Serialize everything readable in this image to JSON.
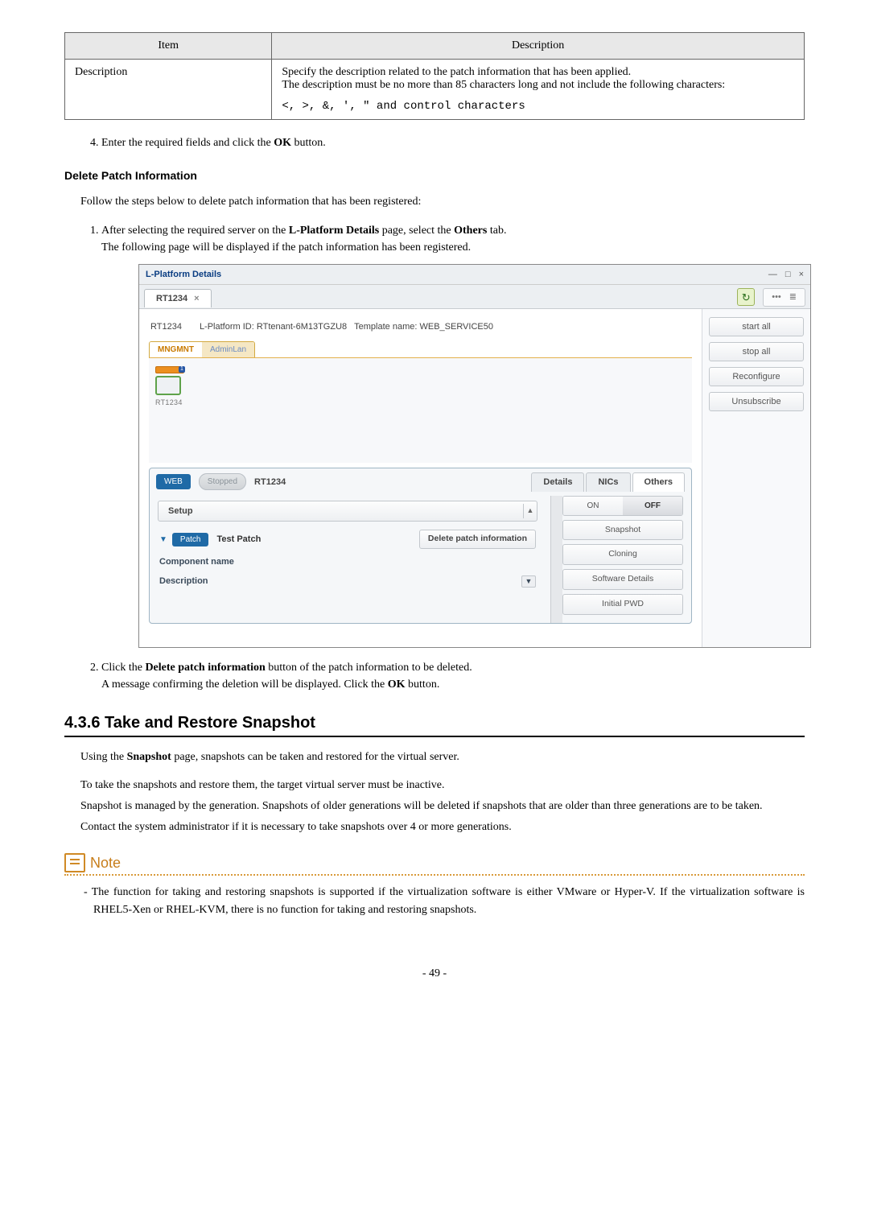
{
  "table": {
    "head_item": "Item",
    "head_desc": "Description",
    "row_item": "Description",
    "row_desc_line1": "Specify the description related to the patch information that has been applied.",
    "row_desc_line2": "The description must be no more than 85 characters long and not include the following characters:",
    "row_desc_code": "<, >, &, ', \" and control characters"
  },
  "step4_prefix": "Enter the required fields and click the ",
  "step4_bold": "OK",
  "step4_suffix": " button.",
  "delete_title": "Delete Patch Information",
  "delete_intro": "Follow the steps below to delete patch information that has been registered:",
  "dstep1_a": "After selecting the required server on the ",
  "dstep1_b": "L-Platform Details",
  "dstep1_c": " page, select the ",
  "dstep1_d": "Others",
  "dstep1_e": " tab.",
  "dstep1_line2": "The following page will be displayed if the patch information has been registered.",
  "ss": {
    "title": "L-Platform Details",
    "tab": "RT1234",
    "toolbar_dots": "•••",
    "refresh_glyph": "↻",
    "info_name": "RT1234",
    "info_lpid_label": "L-Platform ID:",
    "info_lpid_value": "RTtenant-6M13TGZU8",
    "info_tpl_label": "Template name:",
    "info_tpl_value": "WEB_SERVICE50",
    "mngmnt": "MNGMNT",
    "adminlan": "AdminLan",
    "node_label": "RT1234",
    "side": {
      "start_all": "start all",
      "stop_all": "stop all",
      "reconfigure": "Reconfigure",
      "unsubscribe": "Unsubscribe"
    },
    "lower": {
      "web": "WEB",
      "stopped": "Stopped",
      "srv": "RT1234",
      "tab_details": "Details",
      "tab_nics": "NICs",
      "tab_others": "Others",
      "on": "ON",
      "off": "OFF",
      "snapshot": "Snapshot",
      "cloning": "Cloning",
      "swdetails": "Software Details",
      "initialpwd": "Initial PWD",
      "setup": "Setup",
      "patch": "Patch",
      "test_patch": "Test Patch",
      "delete_patch": "Delete patch information",
      "component": "Component name",
      "description": "Description"
    }
  },
  "dstep2_a": "Click the ",
  "dstep2_b": "Delete patch information",
  "dstep2_c": " button of the patch information to be deleted.",
  "dstep2_line2a": "A message confirming the deletion will be displayed. Click the ",
  "dstep2_line2b": "OK",
  "dstep2_line2c": " button.",
  "section_title": "4.3.6  Take and Restore Snapshot",
  "sec_p1_a": "Using the ",
  "sec_p1_b": "Snapshot",
  "sec_p1_c": " page, snapshots can be taken and restored for the virtual server.",
  "sec_p2": "To take the snapshots and restore them, the target virtual server must be inactive.",
  "sec_p3": "Snapshot is managed by the generation. Snapshots of older generations will be deleted if snapshots that are older than three generations are to be taken.",
  "sec_p4": "Contact the system administrator if it is necessary to take snapshots over 4 or more generations.",
  "note_label": "Note",
  "note_item1": "The function for taking and restoring snapshots is supported if the virtualization software is either VMware or Hyper-V. If the virtualization software is RHEL5-Xen or RHEL-KVM, there is no function for taking and restoring snapshots.",
  "page_num": "- 49 -"
}
